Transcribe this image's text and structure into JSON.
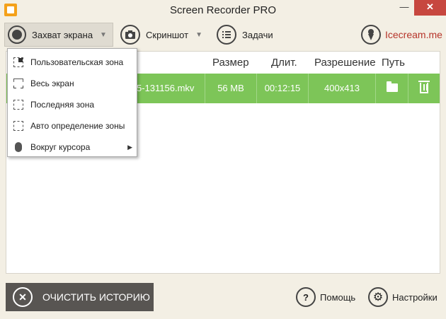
{
  "window": {
    "title": "Screen Recorder PRO",
    "minimize_glyph": "—",
    "close_glyph": "✕"
  },
  "toolbar": {
    "capture_label": "Захват экрана",
    "screenshot_label": "Скриншот",
    "tasks_label": "Задачи",
    "brand_label": "Icecream.me"
  },
  "table": {
    "headers": {
      "size": "Размер",
      "duration": "Длит.",
      "resolution": "Разрешение",
      "path": "Путь"
    },
    "rows": [
      {
        "name": "5-131156.mkv",
        "size": "56 MB",
        "duration": "00:12:15",
        "resolution": "400x413"
      }
    ]
  },
  "capture_menu": {
    "items": [
      {
        "label": "Пользовательская зона",
        "icon": "custom-area-icon"
      },
      {
        "label": "Весь экран",
        "icon": "fullscreen-icon"
      },
      {
        "label": "Последняя зона",
        "icon": "last-area-icon"
      },
      {
        "label": "Авто определение зоны",
        "icon": "auto-detect-icon"
      },
      {
        "label": "Вокруг курсора",
        "icon": "mouse-icon",
        "has_submenu": true
      }
    ]
  },
  "footer": {
    "clear_label": "ОЧИСТИТЬ ИСТОРИЮ",
    "help_label": "Помощь",
    "settings_label": "Настройки"
  },
  "colors": {
    "background": "#f3efe4",
    "row_highlight": "#7dc558",
    "brand": "#b6342a",
    "close_button": "#c7473f",
    "clear_button": "#585552"
  }
}
